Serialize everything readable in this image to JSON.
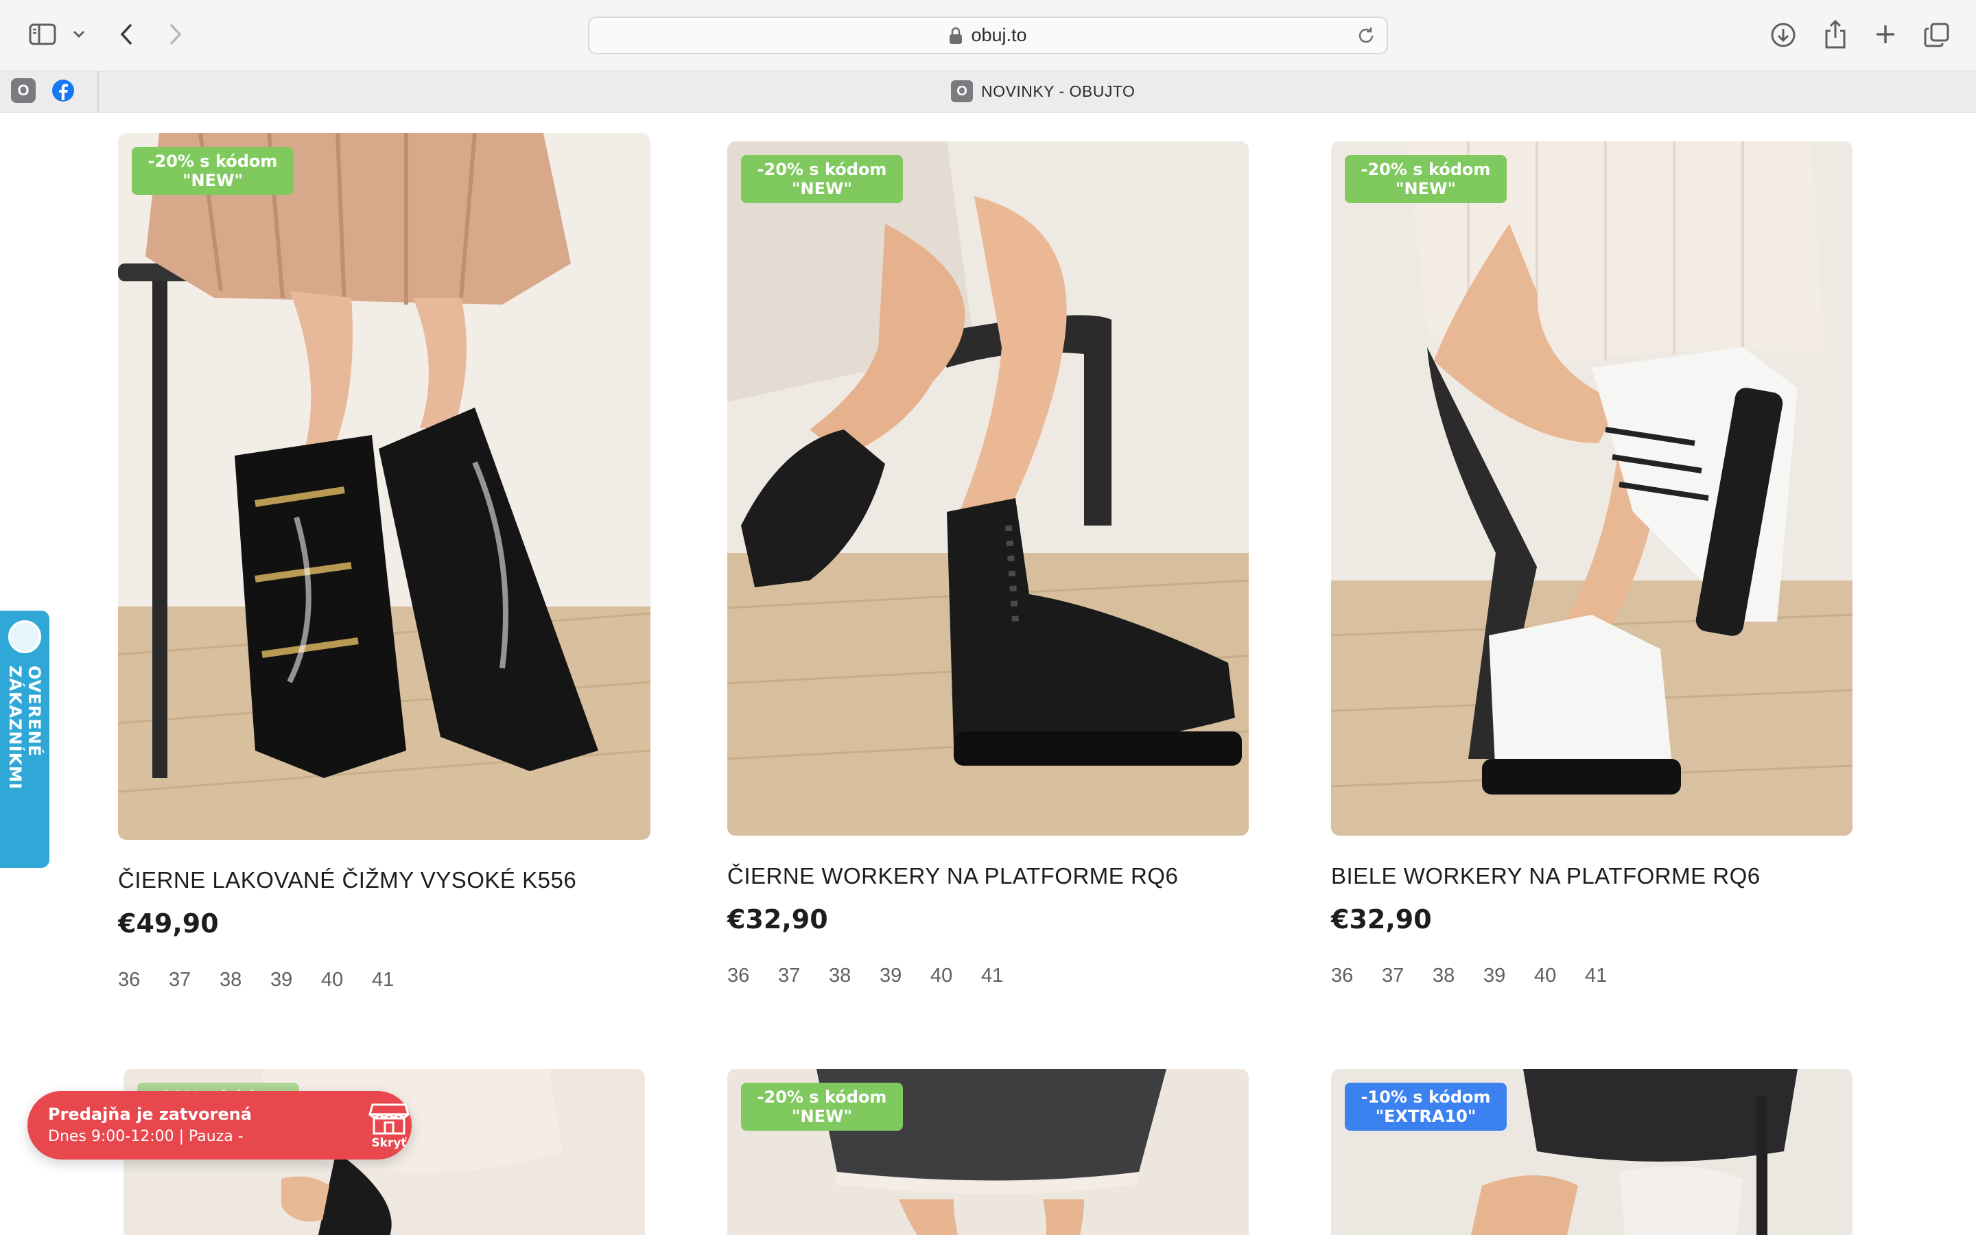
{
  "browser": {
    "url": "obuj.to",
    "tab_title": "NOVINKY - OBUJTO",
    "tab_favicon_letter": "O",
    "pinned_tabs": [
      {
        "name": "obujto",
        "letter": "O"
      },
      {
        "name": "facebook",
        "letter": "f"
      }
    ],
    "icons": [
      "sidebar-icon",
      "chevron-down-icon",
      "back-icon",
      "forward-icon",
      "lock-icon",
      "reload-icon",
      "download-icon",
      "share-icon",
      "new-tab-icon",
      "tab-overview-icon"
    ]
  },
  "products": [
    {
      "badge_line1": "-20% s kódom",
      "badge_line2": "\"NEW\"",
      "badge_color": "#7fc95e",
      "name": "ČIERNE LAKOVANÉ ČIŽMY VYSOKÉ K556",
      "price": "€49,90",
      "sizes": [
        "36",
        "37",
        "38",
        "39",
        "40",
        "41"
      ]
    },
    {
      "badge_line1": "-20% s kódom",
      "badge_line2": "\"NEW\"",
      "badge_color": "#7fc95e",
      "name": "ČIERNE WORKERY NA PLATFORME RQ6",
      "price": "€32,90",
      "sizes": [
        "36",
        "37",
        "38",
        "39",
        "40",
        "41"
      ]
    },
    {
      "badge_line1": "-20% s kódom",
      "badge_line2": "\"NEW\"",
      "badge_color": "#7fc95e",
      "name": "BIELE WORKERY NA PLATFORME RQ6",
      "price": "€32,90",
      "sizes": [
        "36",
        "37",
        "38",
        "39",
        "40",
        "41"
      ]
    },
    {
      "badge_line1": "-20% s kódom",
      "badge_line2": "\"NEW\"",
      "badge_color": "#7fc95e"
    },
    {
      "badge_line1": "-10% s kódom",
      "badge_line2": "\"EXTRA10\"",
      "badge_color": "#3b82f0"
    }
  ],
  "widgets": {
    "verified_label": "OVERENÉ ZÁKAZNÍKMI",
    "store_status": "Predajňa je zatvorená",
    "store_hours": "Dnes 9:00-12:00 | Pauza -",
    "hide_label": "Skryť",
    "store_icon": "storefront-icon"
  }
}
